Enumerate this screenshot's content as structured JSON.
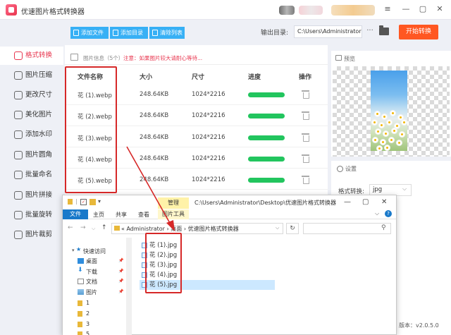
{
  "app": {
    "title": "优速图片格式转换器"
  },
  "window_controls": [
    "⋮",
    "≡",
    "—",
    "✕"
  ],
  "toolbar": {
    "add_file": "添加文件",
    "add_folder": "添加目录",
    "clear_list": "清除列表",
    "output_label": "输出目录:",
    "output_path": "C:\\Users\\Administrator",
    "more": "···",
    "start": "开始转换"
  },
  "sidebar": {
    "items": [
      {
        "label": "格式转换",
        "active": true,
        "icon": "convert-icon"
      },
      {
        "label": "图片压缩",
        "active": false,
        "icon": "compress-icon"
      },
      {
        "label": "更改尺寸",
        "active": false,
        "icon": "resize-icon"
      },
      {
        "label": "美化图片",
        "active": false,
        "icon": "beautify-icon"
      },
      {
        "label": "添加水印",
        "active": false,
        "icon": "watermark-icon"
      },
      {
        "label": "图片圆角",
        "active": false,
        "icon": "round-corner-icon"
      },
      {
        "label": "批量命名",
        "active": false,
        "icon": "rename-icon"
      },
      {
        "label": "图片拼接",
        "active": false,
        "icon": "stitch-icon"
      },
      {
        "label": "批量旋转",
        "active": false,
        "icon": "rotate-icon"
      },
      {
        "label": "图片裁剪",
        "active": false,
        "icon": "crop-icon"
      }
    ]
  },
  "file_list": {
    "info_label": "图片信息（5个）",
    "warning": "注意：如果图片较大请耐心等待...",
    "columns": [
      "文件名称",
      "大小",
      "尺寸",
      "进度",
      "操作"
    ],
    "rows": [
      {
        "name": "花 (1).webp",
        "size": "248.64KB",
        "dims": "1024*2216",
        "progress": 1.0
      },
      {
        "name": "花 (2).webp",
        "size": "248.64KB",
        "dims": "1024*2216",
        "progress": 1.0
      },
      {
        "name": "花 (3).webp",
        "size": "248.64KB",
        "dims": "1024*2216",
        "progress": 1.0
      },
      {
        "name": "花 (4).webp",
        "size": "248.64KB",
        "dims": "1024*2216",
        "progress": 1.0
      },
      {
        "name": "花 (5).webp",
        "size": "248.64KB",
        "dims": "1024*2216",
        "progress": 1.0
      }
    ]
  },
  "preview": {
    "label": "预览"
  },
  "settings": {
    "label": "设置",
    "format_label": "格式转换:",
    "format_value": "jpg"
  },
  "version": "版本：v2.0.5.0",
  "explorer": {
    "manage_tab": "管理",
    "title_path": "C:\\Users\\Administrator\\Desktop\\优速图片格式转换器",
    "ribbon_tabs": [
      "文件",
      "主页",
      "共享",
      "查看",
      "图片工具"
    ],
    "address": [
      "Administrator",
      "桌面",
      "优速图片格式转换器"
    ],
    "nav_items": [
      "快速访问",
      "桌面",
      "下载",
      "文档",
      "图片",
      "1",
      "2",
      "3",
      "5"
    ],
    "files": [
      "花 (1).jpg",
      "花 (2).jpg",
      "花 (3).jpg",
      "花 (4).jpg",
      "花 (5).jpg"
    ],
    "selected_index": 4
  },
  "colors": {
    "accent_red": "#e8354e",
    "button_blue": "#37b0f5",
    "start_orange": "#ff5722",
    "progress_green": "#22c55e",
    "annotation_red": "#d62828"
  }
}
